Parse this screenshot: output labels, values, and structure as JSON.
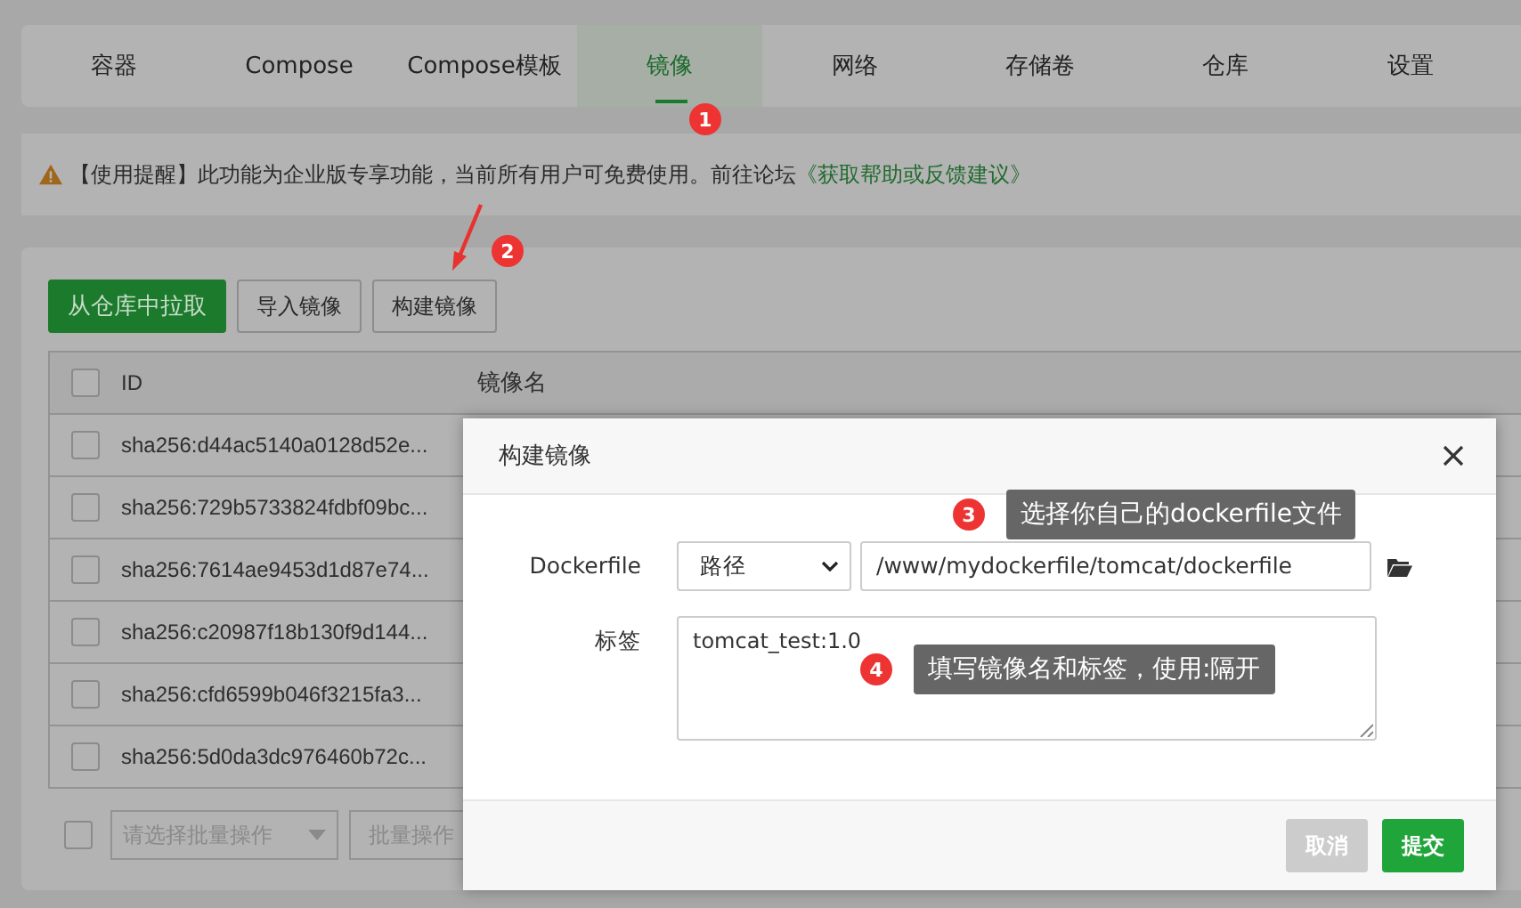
{
  "tabs": [
    {
      "label": "容器",
      "selected": false
    },
    {
      "label": "Compose",
      "selected": false
    },
    {
      "label": "Compose模板",
      "selected": false
    },
    {
      "label": "镜像",
      "selected": true
    },
    {
      "label": "网络",
      "selected": false
    },
    {
      "label": "存储卷",
      "selected": false
    },
    {
      "label": "仓库",
      "selected": false
    },
    {
      "label": "设置",
      "selected": false
    }
  ],
  "notice": {
    "text": "【使用提醒】此功能为企业版专享功能，当前所有用户可免费使用。前往论坛",
    "link": "《获取帮助或反馈建议》"
  },
  "toolbar": [
    {
      "label": "从仓库中拉取",
      "kind": "primary"
    },
    {
      "label": "导入镜像",
      "kind": "default"
    },
    {
      "label": "构建镜像",
      "kind": "default"
    }
  ],
  "table": {
    "columns": [
      "ID",
      "镜像名"
    ],
    "header_checked": false,
    "rows": [
      {
        "id": "sha256:d44ac5140a0128d52e...",
        "checked": false
      },
      {
        "id": "sha256:729b5733824fdbf09bc...",
        "checked": false
      },
      {
        "id": "sha256:7614ae9453d1d87e74...",
        "checked": false
      },
      {
        "id": "sha256:c20987f18b130f9d144...",
        "checked": false
      },
      {
        "id": "sha256:cfd6599b046f3215fa3...",
        "checked": false
      },
      {
        "id": "sha256:5d0da3dc976460b72c...",
        "checked": false
      }
    ]
  },
  "batch": {
    "checked": false,
    "placeholder": "请选择批量操作",
    "button": "批量操作"
  },
  "dialog": {
    "title": "构建镜像",
    "fields": [
      {
        "kind": "path",
        "label": "Dockerfile",
        "select": "路径",
        "value": "/www/mydockerfile/tomcat/dockerfile"
      },
      {
        "kind": "textarea",
        "label": "标签",
        "value": "tomcat_test:1.0"
      }
    ],
    "buttons": [
      {
        "label": "取消",
        "kind": "cancel",
        "disabled": true
      },
      {
        "label": "提交",
        "kind": "submit",
        "disabled": false
      }
    ]
  },
  "annotations": [
    {
      "number": "1"
    },
    {
      "number": "2"
    },
    {
      "number": "3",
      "text": "选择你自己的dockerfile文件"
    },
    {
      "number": "4",
      "text": "填写镜像名和标签，使用:隔开"
    }
  ]
}
